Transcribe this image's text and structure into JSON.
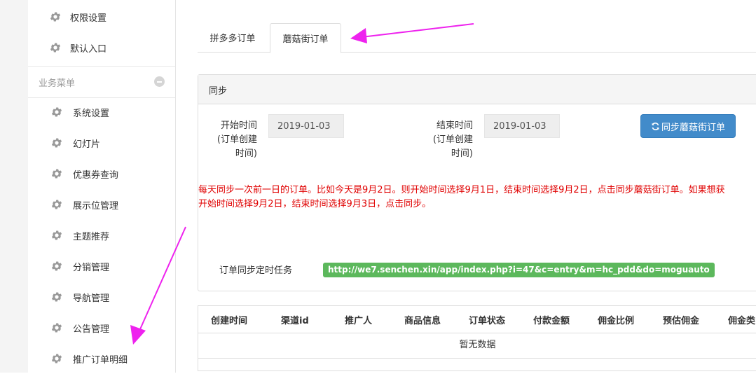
{
  "sidebar": {
    "top_items": [
      {
        "label": "权限设置",
        "icon": "gear-icon"
      },
      {
        "label": "默认入口",
        "icon": "gear-icon"
      }
    ],
    "section_title": "业务菜单",
    "items": [
      {
        "label": "系统设置",
        "icon": "gear-icon"
      },
      {
        "label": "幻灯片",
        "icon": "gear-icon"
      },
      {
        "label": "优惠券查询",
        "icon": "gear-icon"
      },
      {
        "label": "展示位管理",
        "icon": "gear-icon"
      },
      {
        "label": "主题推荐",
        "icon": "gear-icon"
      },
      {
        "label": "分销管理",
        "icon": "gear-icon"
      },
      {
        "label": "导航管理",
        "icon": "gear-icon"
      },
      {
        "label": "公告管理",
        "icon": "gear-icon"
      },
      {
        "label": "推广订单明细",
        "icon": "gear-icon"
      }
    ]
  },
  "tabs": [
    "拼多多订单",
    "蘑菇街订单"
  ],
  "active_tab": "蘑菇街订单",
  "panel": {
    "title": "同步",
    "start_label": [
      "开始时间",
      "(订单创建",
      "时间)"
    ],
    "start_value": "2019-01-03",
    "end_label": [
      "结束时间",
      "(订单创建",
      "时间)"
    ],
    "end_value": "2019-01-03",
    "sync_button": "同步蘑菇街订单",
    "notice_line1": "每天同步一次前一日的订单。比如今天是9月2日。则开始时间选择9月1日，结束时间选择9月2日，点击同步蘑菇街订单。如果想获",
    "notice_line2": "开始时间选择9月2日，结束时间选择9月3日，点击同步。",
    "task_label": "订单同步定时任务",
    "task_url": "http://we7.senchen.xin/app/index.php?i=47&c=entry&m=hc_pdd&do=moguauto"
  },
  "table": {
    "headers": [
      "创建时间",
      "渠道id",
      "推广人",
      "商品信息",
      "订单状态",
      "付款金额",
      "佣金比例",
      "预估佣金",
      "佣金类"
    ],
    "empty_text": "暂无数据"
  },
  "colors": {
    "primary_button": "#428bca",
    "url_badge": "#5cb85c",
    "notice_text": "#e00000",
    "annotation_arrow": "#ee22ee"
  }
}
